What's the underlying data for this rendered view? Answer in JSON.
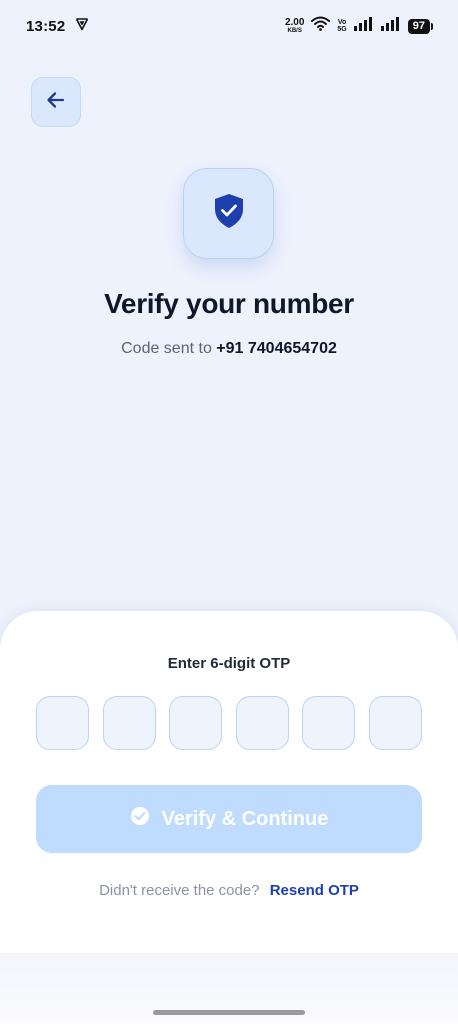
{
  "status_bar": {
    "time": "13:52",
    "net_speed_value": "2.00",
    "net_speed_unit": "KB/S",
    "volte_top": "Vo",
    "volte_bottom": "5G",
    "battery": "97"
  },
  "icons": {
    "back": "arrow-left-icon",
    "shield": "shield-check-icon",
    "verify": "check-circle-icon"
  },
  "header": {
    "title": "Verify your number",
    "subtitle_prefix": "Code sent to",
    "phone": "+91 7404654702"
  },
  "otp": {
    "label": "Enter 6-digit OTP",
    "digits": [
      "",
      "",
      "",
      "",
      "",
      ""
    ]
  },
  "actions": {
    "verify_label": "Verify & Continue",
    "resend_prompt": "Didn't receive the code?",
    "resend_label": "Resend OTP"
  },
  "colors": {
    "background": "#eef2fd",
    "accent": "#1e40af",
    "button_disabled": "#bfdbfd",
    "tile": "#dbe7fd"
  }
}
